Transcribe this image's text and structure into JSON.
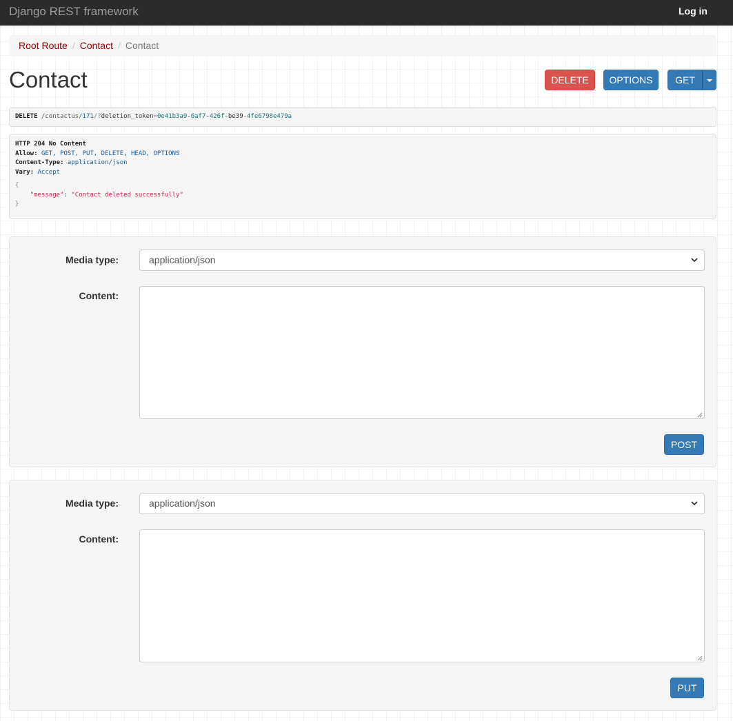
{
  "navbar": {
    "brand": "Django REST framework",
    "login": "Log in"
  },
  "breadcrumb": [
    {
      "label": "Root Route",
      "active": false
    },
    {
      "label": "Contact",
      "active": false
    },
    {
      "label": "Contact",
      "active": true
    }
  ],
  "page": {
    "title": "Contact"
  },
  "actions": {
    "delete": "DELETE",
    "options": "OPTIONS",
    "get": "GET"
  },
  "request": {
    "method": "DELETE",
    "path_1": "/contactus",
    "path_2": "/171",
    "path_3": "/?",
    "param_key": "deletion_token",
    "param_eq": "=",
    "param_val_a": "0e41b3a9",
    "param_sep_1": "-",
    "param_val_b": "6af7",
    "param_sep_2": "-",
    "param_val_c": "426f",
    "param_sep_3": "-be39-",
    "param_val_d": "4fe6798e479a"
  },
  "response": {
    "status": "HTTP 204 No Content",
    "allow_label": "Allow:",
    "allow_value": "GET, POST, PUT, DELETE, HEAD, OPTIONS",
    "content_type_label": "Content-Type:",
    "content_type_value": "application/json",
    "vary_label": "Vary:",
    "vary_value": "Accept",
    "body_open": "{",
    "body_key": "\"message\"",
    "body_colon": ": ",
    "body_value": "\"Contact deleted successfully\"",
    "body_close": "}"
  },
  "forms": [
    {
      "media_type_label": "Media type:",
      "media_type_value": "application/json",
      "content_label": "Content:",
      "content_value": "",
      "submit": "POST"
    },
    {
      "media_type_label": "Media type:",
      "media_type_value": "application/json",
      "content_label": "Content:",
      "content_value": "",
      "submit": "PUT"
    }
  ],
  "colors": {
    "navbar_bg": "#2b2b2b",
    "danger": "#d9534f",
    "primary": "#337ab7",
    "breadcrumb_link": "#8b0000"
  },
  "icons": {
    "select_chevron": "chevron-down-icon",
    "dropdown_caret": "caret-down-icon",
    "resize_grip": "resize-grip-icon"
  }
}
